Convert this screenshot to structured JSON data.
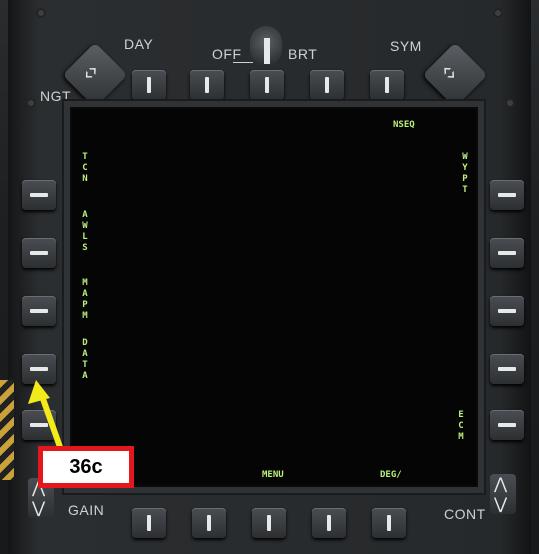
{
  "top_labels": {
    "day": "DAY",
    "off": "OFF",
    "brt": "BRT",
    "sym": "SYM",
    "ngt": "NGT"
  },
  "bottom_labels": {
    "gain": "GAIN",
    "cont": "CONT"
  },
  "mfd": {
    "nseq": "NSEQ",
    "menu": "MENU",
    "deg": "DEG/",
    "left_options": [
      "TCN",
      "AWLS",
      "MAPM",
      "DATA"
    ],
    "right_options": [
      "WYPT",
      "ECM"
    ]
  },
  "callout": {
    "label": "36c"
  },
  "colors": {
    "mfd_text": "#b9f07a",
    "callout_border": "#e3171c",
    "arrow": "#f2ea1b"
  },
  "icons": {
    "rocker_up": "chevron-double-icon",
    "knob": "brightness-knob-icon"
  }
}
